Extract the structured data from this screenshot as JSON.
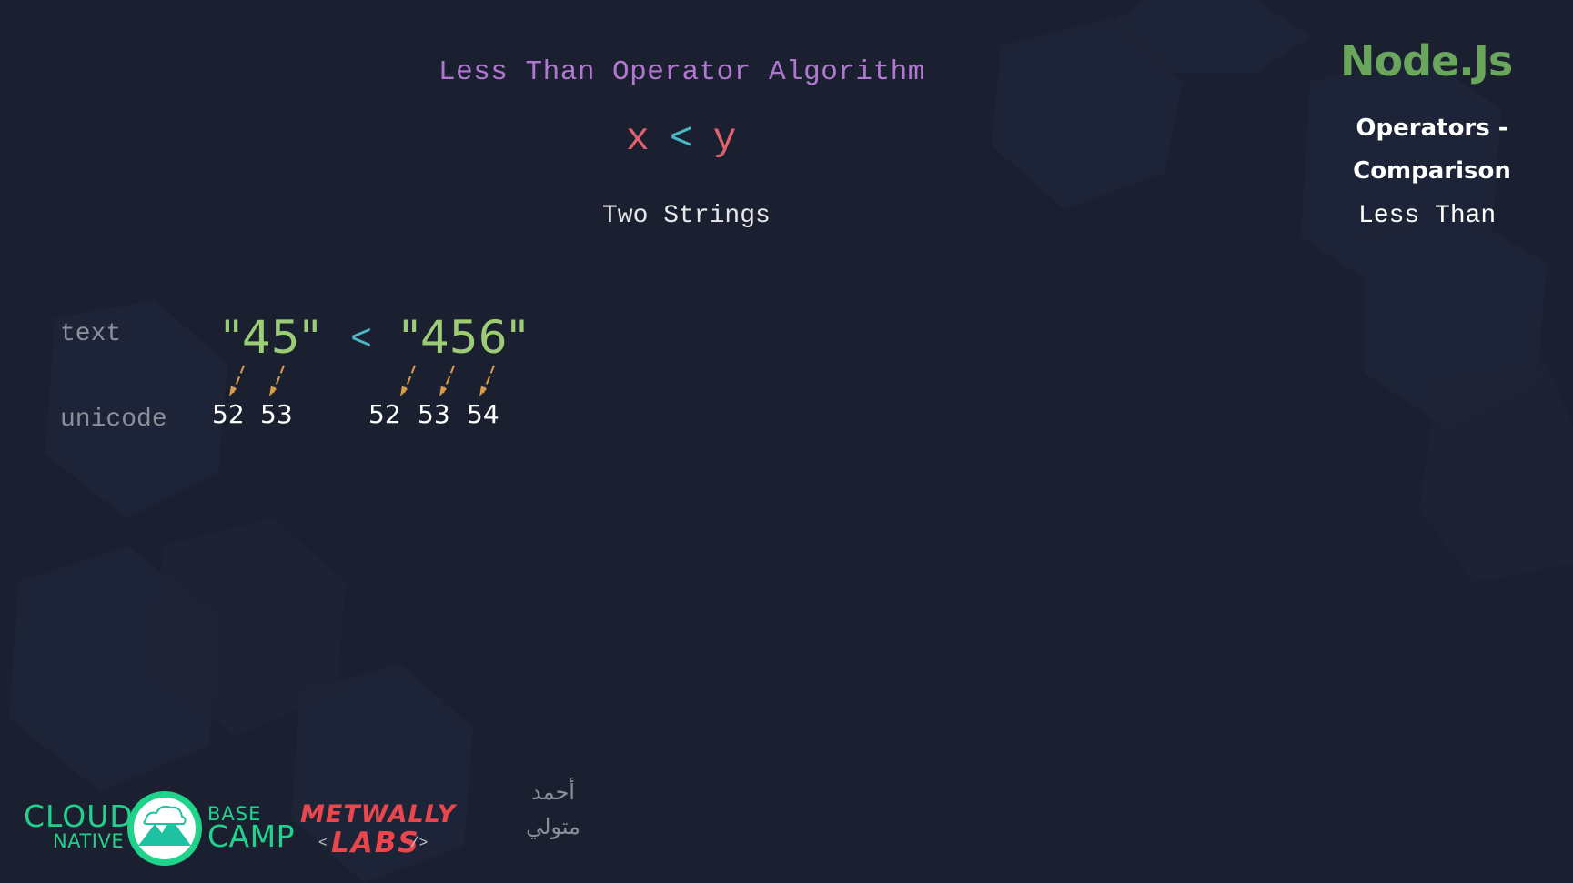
{
  "colors": {
    "background": "#1b2030",
    "title": "#b177d1",
    "operand": "#e0626e",
    "operator": "#4cb7c6",
    "string": "#9ccc74",
    "arrow": "#d99a4e",
    "brand": "#6aa75c",
    "logo_green": "#1fd38b",
    "logo_red": "#e9474d"
  },
  "slide": {
    "title": "Less Than Operator Algorithm",
    "expr": {
      "x": "x",
      "op": "<",
      "y": "y"
    },
    "subtitle": "Two Strings"
  },
  "sidebar": {
    "brand": "Node.Js",
    "topic_line1": "Operators -",
    "topic_line2": "Comparison",
    "subtopic": "Less Than"
  },
  "example": {
    "label_text": "text",
    "label_unicode": "unicode",
    "left_string": "\"45\"",
    "operator": "<",
    "right_string": "\"456\"",
    "left_codes": [
      "52",
      "53"
    ],
    "right_codes": [
      "52",
      "53",
      "54"
    ]
  },
  "logos": {
    "cloud": "CLOUD",
    "native": "NATIVE",
    "base": "BASE",
    "camp": "CAMP",
    "metwally": "METWALLY",
    "labs": "LABS",
    "labs_open": "<",
    "labs_close": "/>",
    "arabic_line1": "أحمد",
    "arabic_line2": "متولي"
  }
}
